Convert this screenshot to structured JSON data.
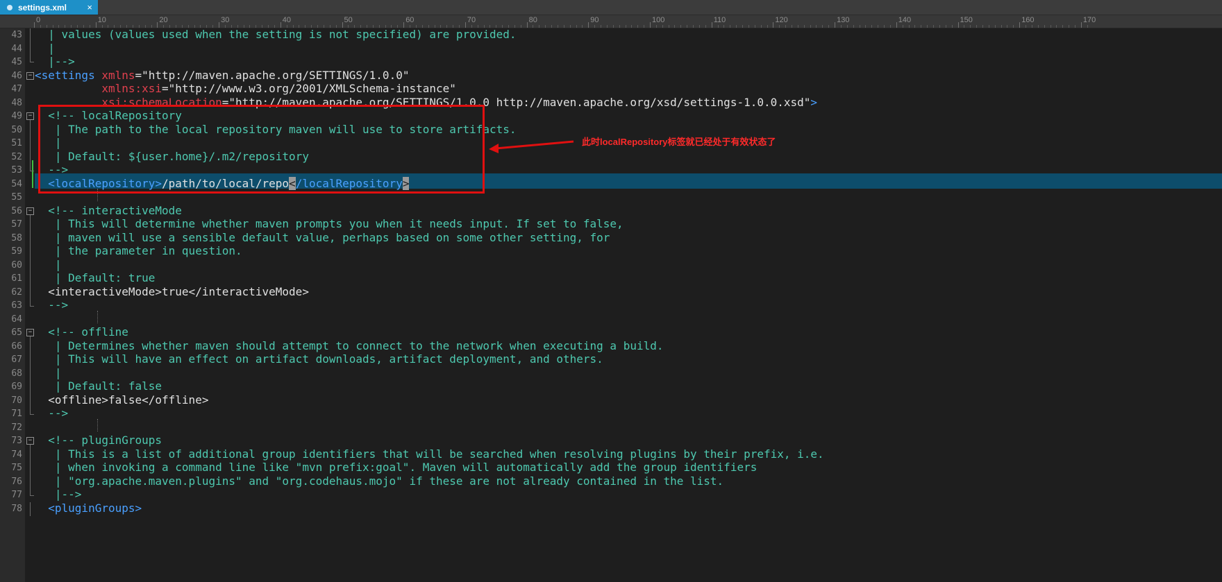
{
  "tab": {
    "title": "settings.xml",
    "close": "×",
    "icon": "file-icon"
  },
  "ruler": {
    "labels": [
      "0",
      "10",
      "20",
      "30",
      "40",
      "50",
      "60",
      "70",
      "80",
      "90",
      "100",
      "110",
      "120",
      "130",
      "140",
      "150",
      "160",
      "170"
    ]
  },
  "colors": {
    "comment": "#4ec9b0",
    "tag": "#4aa0ff",
    "attribute": "#e0404e",
    "text": "#e0e0e0",
    "highlight_line": "#0d4d6b",
    "annotation": "#ff2a2a"
  },
  "lines": [
    {
      "n": "43",
      "t": "  | values (values used when the setting is not specified) are provided."
    },
    {
      "n": "44",
      "t": "  |"
    },
    {
      "n": "45",
      "t": "  |-->"
    },
    {
      "n": "46",
      "t": "<settings xmlns=\"http://maven.apache.org/SETTINGS/1.0.0\""
    },
    {
      "n": "47",
      "t": "          xmlns:xsi=\"http://www.w3.org/2001/XMLSchema-instance\""
    },
    {
      "n": "48",
      "t": "          xsi:schemaLocation=\"http://maven.apache.org/SETTINGS/1.0.0 http://maven.apache.org/xsd/settings-1.0.0.xsd\">"
    },
    {
      "n": "49",
      "t": "  <!-- localRepository"
    },
    {
      "n": "50",
      "t": "   | The path to the local repository maven will use to store artifacts."
    },
    {
      "n": "51",
      "t": "   |"
    },
    {
      "n": "52",
      "t": "   | Default: ${user.home}/.m2/repository"
    },
    {
      "n": "53",
      "t": "  -->"
    },
    {
      "n": "54",
      "t": "  <localRepository>/path/to/local/repo</localRepository>"
    },
    {
      "n": "55",
      "t": ""
    },
    {
      "n": "56",
      "t": "  <!-- interactiveMode"
    },
    {
      "n": "57",
      "t": "   | This will determine whether maven prompts you when it needs input. If set to false,"
    },
    {
      "n": "58",
      "t": "   | maven will use a sensible default value, perhaps based on some other setting, for"
    },
    {
      "n": "59",
      "t": "   | the parameter in question."
    },
    {
      "n": "60",
      "t": "   |"
    },
    {
      "n": "61",
      "t": "   | Default: true"
    },
    {
      "n": "62",
      "t": "  <interactiveMode>true</interactiveMode>"
    },
    {
      "n": "63",
      "t": "  -->"
    },
    {
      "n": "64",
      "t": ""
    },
    {
      "n": "65",
      "t": "  <!-- offline"
    },
    {
      "n": "66",
      "t": "   | Determines whether maven should attempt to connect to the network when executing a build."
    },
    {
      "n": "67",
      "t": "   | This will have an effect on artifact downloads, artifact deployment, and others."
    },
    {
      "n": "68",
      "t": "   |"
    },
    {
      "n": "69",
      "t": "   | Default: false"
    },
    {
      "n": "70",
      "t": "  <offline>false</offline>"
    },
    {
      "n": "71",
      "t": "  -->"
    },
    {
      "n": "72",
      "t": ""
    },
    {
      "n": "73",
      "t": "  <!-- pluginGroups"
    },
    {
      "n": "74",
      "t": "   | This is a list of additional group identifiers that will be searched when resolving plugins by their prefix, i.e."
    },
    {
      "n": "75",
      "t": "   | when invoking a command line like \"mvn prefix:goal\". Maven will automatically add the group identifiers"
    },
    {
      "n": "76",
      "t": "   | \"org.apache.maven.plugins\" and \"org.codehaus.mojo\" if these are not already contained in the list."
    },
    {
      "n": "77",
      "t": "   |-->"
    },
    {
      "n": "78",
      "t": "  <pluginGroups>"
    }
  ],
  "annotation": {
    "text": "此时localRepository标签就已经处于有效状态了"
  }
}
